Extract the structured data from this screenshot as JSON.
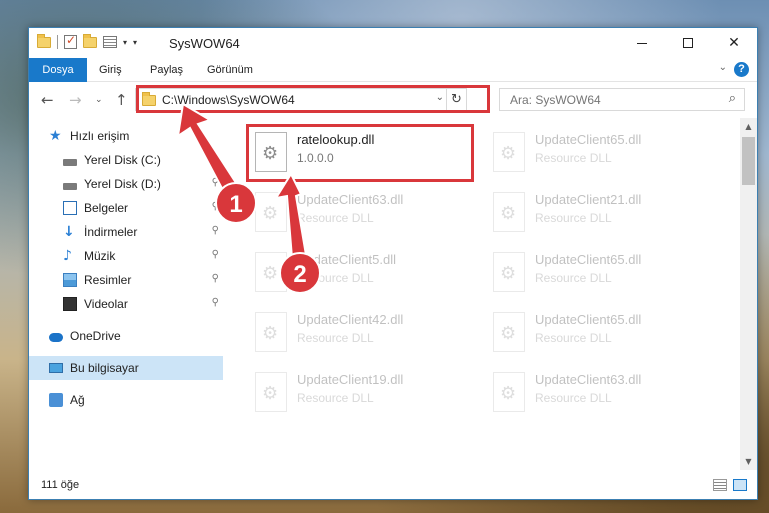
{
  "window": {
    "title": "SysWOW64"
  },
  "ribbon": {
    "tabs": [
      "Dosya",
      "Giriş",
      "Paylaş",
      "Görünüm"
    ]
  },
  "address": {
    "path": "C:\\Windows\\SysWOW64"
  },
  "search": {
    "placeholder": "Ara: SysWOW64"
  },
  "sidebar": {
    "items": [
      {
        "label": "Hızlı erişim"
      },
      {
        "label": "Yerel Disk (C:)"
      },
      {
        "label": "Yerel Disk (D:)"
      },
      {
        "label": "Belgeler"
      },
      {
        "label": "İndirmeler"
      },
      {
        "label": "Müzik"
      },
      {
        "label": "Resimler"
      },
      {
        "label": "Videolar"
      },
      {
        "label": "OneDrive"
      },
      {
        "label": "Bu bilgisayar"
      },
      {
        "label": "Ağ"
      }
    ]
  },
  "files": [
    {
      "name": "ratelookup.dll",
      "desc": "1.0.0.0"
    },
    {
      "name": "UpdateClient65.dll",
      "desc": "Resource DLL"
    },
    {
      "name": "UpdateClient63.dll",
      "desc": "Resource DLL"
    },
    {
      "name": "UpdateClient21.dll",
      "desc": "Resource DLL"
    },
    {
      "name": "UpdateClient5.dll",
      "desc": "Resource DLL"
    },
    {
      "name": "UpdateClient65.dll",
      "desc": "Resource DLL"
    },
    {
      "name": "UpdateClient42.dll",
      "desc": "Resource DLL"
    },
    {
      "name": "UpdateClient65.dll",
      "desc": "Resource DLL"
    },
    {
      "name": "UpdateClient19.dll",
      "desc": "Resource DLL"
    },
    {
      "name": "UpdateClient63.dll",
      "desc": "Resource DLL"
    }
  ],
  "status": {
    "count": "111 öğe"
  },
  "callouts": {
    "first": "1",
    "second": "2"
  },
  "colors": {
    "accent": "#1979ca",
    "highlight": "#d9373b",
    "selected": "#cce4f7"
  }
}
